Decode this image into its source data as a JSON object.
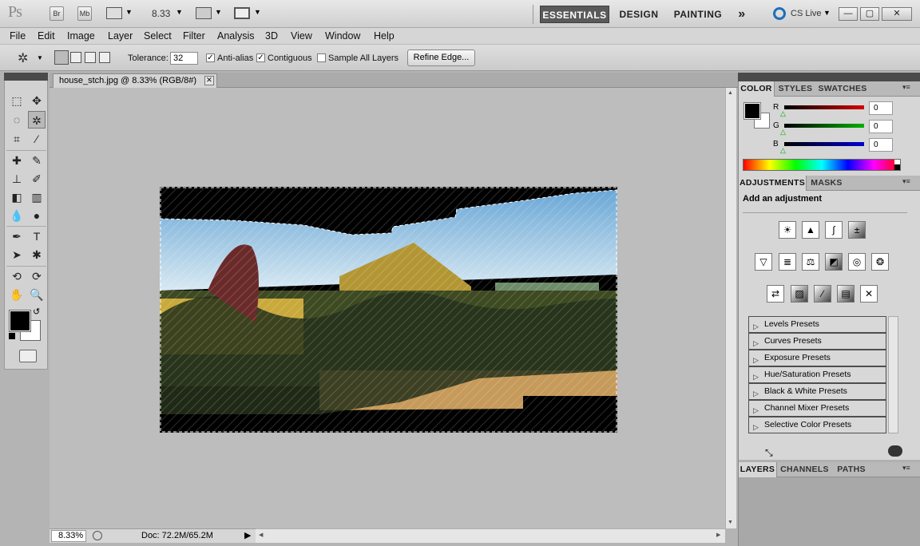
{
  "app": {
    "logo": "Ps",
    "br": "Br",
    "mb": "Mb",
    "zoom": "8.33"
  },
  "workspaces": {
    "essentials": "ESSENTIALS",
    "design": "DESIGN",
    "painting": "PAINTING",
    "more": "»",
    "cslive": "CS Live"
  },
  "window_buttons": {
    "minimize": "—",
    "maximize": "▢",
    "close": "✕"
  },
  "menu": [
    "File",
    "Edit",
    "Image",
    "Layer",
    "Select",
    "Filter",
    "Analysis",
    "3D",
    "View",
    "Window",
    "Help"
  ],
  "options": {
    "tolerance_label": "Tolerance:",
    "tolerance_value": "32",
    "antialias": "Anti-alias",
    "contiguous": "Contiguous",
    "sample_all": "Sample All Layers",
    "refine_edge": "Refine Edge...",
    "antialias_checked": true,
    "contiguous_checked": true,
    "sample_checked": false
  },
  "document": {
    "tab_title": "house_stch.jpg @ 8.33% (RGB/8#)",
    "close": "⨯"
  },
  "status": {
    "zoom": "8.33%",
    "doc": "Doc: 72.2M/65.2M"
  },
  "color_panel": {
    "tabs": [
      "COLOR",
      "STYLES",
      "SWATCHES"
    ],
    "channels": [
      {
        "label": "R",
        "value": "0",
        "color": "#d40000"
      },
      {
        "label": "G",
        "value": "0",
        "color": "#00b000"
      },
      {
        "label": "B",
        "value": "0",
        "color": "#0000d0"
      }
    ]
  },
  "adjustments_panel": {
    "tabs": [
      "ADJUSTMENTS",
      "MASKS"
    ],
    "heading": "Add an adjustment",
    "presets": [
      "Levels Presets",
      "Curves Presets",
      "Exposure Presets",
      "Hue/Saturation Presets",
      "Black & White Presets",
      "Channel Mixer Presets",
      "Selective Color Presets"
    ]
  },
  "layers_panel": {
    "tabs": [
      "LAYERS",
      "CHANNELS",
      "PATHS"
    ]
  },
  "colors": {
    "accent": "#5a5a5a",
    "panel": "#d6d6d6"
  }
}
